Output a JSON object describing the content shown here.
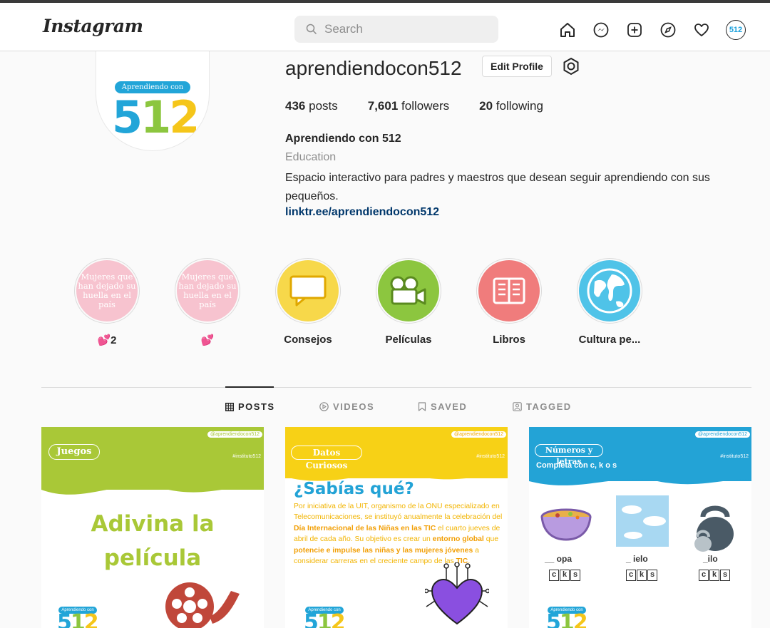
{
  "app": {
    "logo": "Instagram"
  },
  "search": {
    "placeholder": "Search"
  },
  "nav": {
    "icons": [
      "home-icon",
      "messenger-icon",
      "new-post-icon",
      "explore-icon",
      "activity-heart-icon",
      "profile-avatar"
    ],
    "avatar_text": "512"
  },
  "profile": {
    "username": "aprendiendocon512",
    "edit_label": "Edit Profile",
    "posts_count": "436",
    "posts_label": "posts",
    "followers_count": "7,601",
    "followers_label": "followers",
    "following_count": "20",
    "following_label": "following",
    "full_name": "Aprendiendo con 512",
    "category": "Education",
    "bio": "Espacio interactivo para padres y maestros que desean seguir aprendiendo con sus pequeños.",
    "link": "linktr.ee/aprendiendocon512",
    "pic_badge": "Aprendiendo con",
    "pic_number": [
      "5",
      "1",
      "2"
    ]
  },
  "highlights": [
    {
      "label": "💕2",
      "cover_text": "Mujeres que han dejado su huella en el país"
    },
    {
      "label": "💕",
      "cover_text": "Mujeres que han dejado su huella en el país"
    },
    {
      "label": "Consejos",
      "icon": "speech-bubble-icon"
    },
    {
      "label": "Películas",
      "icon": "video-camera-icon"
    },
    {
      "label": "Libros",
      "icon": "book-icon"
    },
    {
      "label": "Cultura pe...",
      "icon": "globe-icon"
    }
  ],
  "tabs": [
    {
      "label": "POSTS",
      "icon": "grid-icon",
      "active": true
    },
    {
      "label": "VIDEOS",
      "icon": "play-circle-icon",
      "active": false
    },
    {
      "label": "SAVED",
      "icon": "bookmark-icon",
      "active": false
    },
    {
      "label": "TAGGED",
      "icon": "tagged-person-icon",
      "active": false
    }
  ],
  "posts": [
    {
      "pill": "Juegos",
      "handle": "@aprendiendocon512",
      "tag": "#instituto512",
      "title_line1": "Adivina la",
      "title_line2": "película",
      "colors": {
        "band": "#a9c837"
      }
    },
    {
      "pill": "Datos Curiosos",
      "handle": "@aprendiendocon512",
      "tag": "#instituto512",
      "heading": "¿Sabías qué?",
      "body": [
        "Por iniciativa de la UIT, organismo de la ONU especializado en Telecomunicaciones, se instituyó anualmente la celebración del ",
        "Día Internacional de las Niñas en las TIC",
        " el cuarto jueves de abril de cada año. Su objetivo es crear un ",
        "entorno global",
        " que ",
        "potencie e impulse las niñas y las mujeres jóvenes",
        " a considerar carreras en el creciente campo de las ",
        "TIC",
        "."
      ],
      "colors": {
        "band": "#f7d116"
      }
    },
    {
      "pill": "Números y letras",
      "handle": "@aprendiendocon512",
      "tag": "#instituto512",
      "subtitle": "Completa con c, k o s",
      "words": [
        "__ opa",
        "_ ielo",
        "_ilo"
      ],
      "letters": [
        "c",
        "k",
        "s"
      ],
      "colors": {
        "band": "#23a3d6"
      }
    }
  ],
  "mini_badge": "Aprendiendo con",
  "colors": {
    "link": "#00376b",
    "secondary_text": "#8e8e8e",
    "blue": "#22a5d8",
    "green": "#8cc63f",
    "yellow": "#f5c61a"
  }
}
